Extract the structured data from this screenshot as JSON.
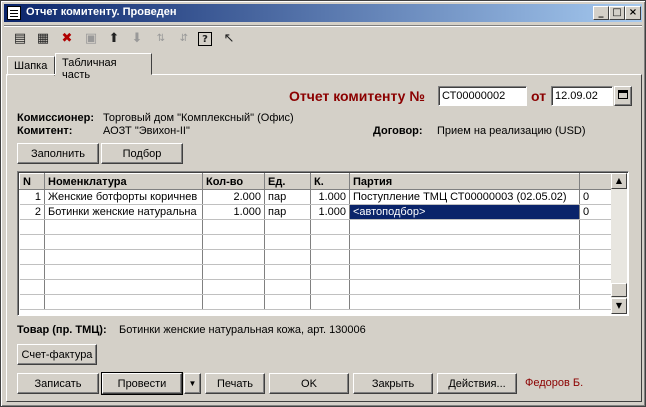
{
  "window": {
    "title": "Отчет комитенту. Проведен",
    "min_label": "_",
    "max_label": "□",
    "close_label": "×"
  },
  "toolbar": {
    "icons": [
      "new-row-icon",
      "add-row-icon",
      "delete-row-icon",
      "copy-row-icon",
      "move-up-icon",
      "move-down-icon",
      "sort-asc-icon",
      "sort-desc-icon",
      "help-icon",
      "whats-this-icon"
    ]
  },
  "tabs": [
    {
      "label": "Шапка",
      "active": false
    },
    {
      "label": "Табличная часть",
      "active": true
    }
  ],
  "header": {
    "doc_label": "Отчет комитенту №",
    "doc_number": "СТ00000002",
    "date_label": "от",
    "doc_date": "12.09.02",
    "accent_color": "#8b0000"
  },
  "info": {
    "commissioner_label": "Комиссионер:",
    "commissioner_value": "Торговый дом \"Комплексный\" (Офис)",
    "consignor_label": "Комитент:",
    "consignor_value": "АОЗТ \"Эвихон-II\"",
    "contract_label": "Договор:",
    "contract_value": "Прием на реализацию (USD)"
  },
  "actions_top": {
    "fill_label": "Заполнить",
    "select_label": "Подбор"
  },
  "table": {
    "columns": [
      "N",
      "Номенклатура",
      "Кол-во",
      "Ед.",
      "К.",
      "Партия",
      ""
    ],
    "rows": [
      {
        "n": "1",
        "item": "Женские ботфорты коричнев",
        "qty": "2.000",
        "unit": "пар",
        "k": "1.000",
        "batch": "Поступление ТМЦ СТ00000003 (02.05.02)",
        "extra": "0"
      },
      {
        "n": "2",
        "item": "Ботинки женские натуральна",
        "qty": "1.000",
        "unit": "пар",
        "k": "1.000",
        "batch": "<автоподбор>",
        "extra": "0"
      }
    ]
  },
  "product": {
    "label": "Товар (пр. ТМЦ):",
    "value": "Ботинки женские натуральная кожа, арт. 130006"
  },
  "invoice_label": "Счет-фактура",
  "footer": {
    "save_label": "Записать",
    "post_label": "Провести",
    "print_label": "Печать",
    "ok_label": "OK",
    "close_label": "Закрыть",
    "actions_label": "Действия...",
    "user": "Федоров Б."
  }
}
